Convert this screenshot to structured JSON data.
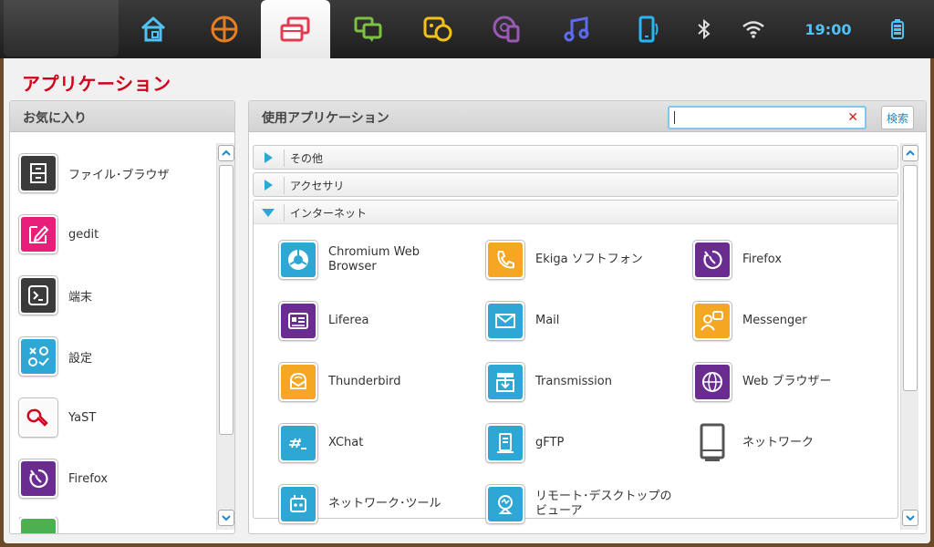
{
  "topbar": {
    "tabs": [
      {
        "icon": "home-icon"
      },
      {
        "icon": "pinwheel-icon"
      },
      {
        "icon": "windows-icon",
        "active": true
      },
      {
        "icon": "chat-icon"
      },
      {
        "icon": "contacts-icon"
      },
      {
        "icon": "media-icon"
      },
      {
        "icon": "music-icon"
      },
      {
        "icon": "phone-sync-icon"
      }
    ],
    "time": "19:00",
    "status_icons": [
      "bluetooth-icon",
      "wifi-icon",
      "battery-icon"
    ]
  },
  "window": {
    "title": "アプリケーション"
  },
  "favorites": {
    "title": "お気に入り",
    "items": [
      {
        "label": "ファイル･ブラウザ",
        "icon": "file-cabinet-icon"
      },
      {
        "label": "gedit",
        "icon": "edit-icon"
      },
      {
        "label": "端末",
        "icon": "terminal-icon"
      },
      {
        "label": "設定",
        "icon": "settings-icon"
      },
      {
        "label": "YaST",
        "icon": "wrench-icon"
      },
      {
        "label": "Firefox",
        "icon": "firefox-icon"
      }
    ]
  },
  "apps": {
    "title": "使用アプリケーション",
    "search_button": "検索",
    "search_value": "",
    "categories": [
      {
        "label": "その他",
        "expanded": false
      },
      {
        "label": "アクセサリ",
        "expanded": false
      },
      {
        "label": "インターネット",
        "expanded": true
      }
    ],
    "internet_apps": [
      {
        "label": "Chromium Web Browser",
        "icon": "chromium-icon"
      },
      {
        "label": "Ekiga ソフトフォン",
        "icon": "phone-icon"
      },
      {
        "label": "Firefox",
        "icon": "firefox-icon"
      },
      {
        "label": "Liferea",
        "icon": "news-icon"
      },
      {
        "label": "Mail",
        "icon": "mail-icon"
      },
      {
        "label": "Messenger",
        "icon": "messenger-icon"
      },
      {
        "label": "Thunderbird",
        "icon": "thunderbird-icon"
      },
      {
        "label": "Transmission",
        "icon": "transmission-icon"
      },
      {
        "label": "Web ブラウザー",
        "icon": "globe-icon"
      },
      {
        "label": "XChat",
        "icon": "xchat-icon"
      },
      {
        "label": "gFTP",
        "icon": "server-icon"
      },
      {
        "label": "ネットワーク",
        "icon": "device-icon"
      },
      {
        "label": "ネットワーク･ツール",
        "icon": "network-tool-icon"
      },
      {
        "label": "リモート･デスクトップの ビューア",
        "icon": "remote-desktop-icon"
      }
    ]
  },
  "colors": {
    "accent_red": "#d0021b",
    "topbar_blue": "#4fc3f7",
    "purple": "#6a2c91",
    "cyan": "#2fa7d4",
    "orange": "#f5a623",
    "dark": "#333333",
    "pink": "#e91e7a"
  }
}
